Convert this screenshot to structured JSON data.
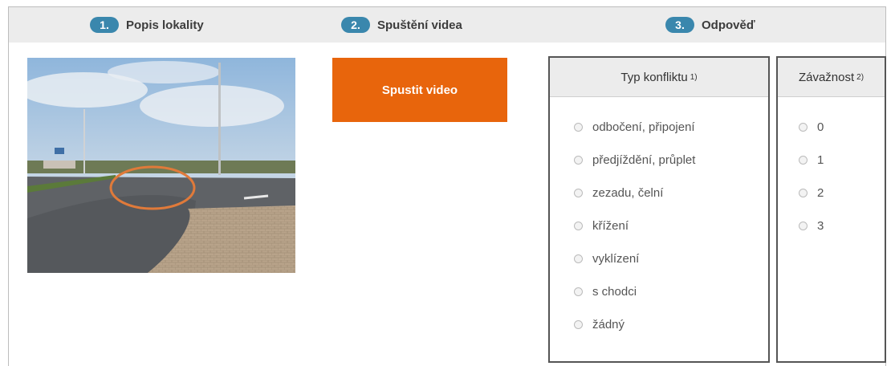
{
  "steps": [
    {
      "number": "1.",
      "label": "Popis lokality"
    },
    {
      "number": "2.",
      "label": "Spuštění videa"
    },
    {
      "number": "3.",
      "label": "Odpověď"
    }
  ],
  "video_button": {
    "label": "Spustit video"
  },
  "conflict_panel": {
    "title": "Typ konfliktu",
    "footnote": "1)",
    "options": [
      "odbočení, připojení",
      "předjíždění, průplet",
      "zezadu, čelní",
      "křížení",
      "vyklízení",
      "s chodci",
      "žádný"
    ]
  },
  "severity_panel": {
    "title": "Závažnost",
    "footnote": "2)",
    "options": [
      "0",
      "1",
      "2",
      "3"
    ]
  },
  "colors": {
    "accent": "#e8650c",
    "step_badge": "#3a87ad",
    "bar": "#ececec"
  }
}
